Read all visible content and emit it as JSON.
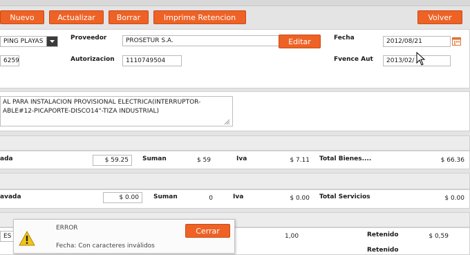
{
  "toolbar": {
    "nuevo": "Nuevo",
    "actualizar": "Actualizar",
    "borrar": "Borrar",
    "imprime": "Imprime Retencion",
    "volver": "Volver"
  },
  "header": {
    "select_value": "PING PLAYAS",
    "proveedor_label": "Proveedor",
    "proveedor_value": "PROSETUR S.A.",
    "editar": "Editar",
    "fecha_label": "Fecha",
    "fecha_value": "2012/08/21",
    "code_value": "6259",
    "autorizacion_label": "Autorizacion",
    "autorizacion_value": "1110749504",
    "fvence_label": "Fvence Aut",
    "fvence_value": "2013/02/"
  },
  "description": {
    "line1": "AL PARA INSTALACION PROVISIONAL ELECTRICA(INTERRUPTOR-",
    "line2": "ABLE#12-PICAPORTE-DISCO14\"-TIZA INDUSTRIAL)"
  },
  "bienes": {
    "gravada_label": "ada",
    "gravada_value": "$ 59.25",
    "suman_label": "Suman",
    "suman_value": "$ 59",
    "iva_label": "Iva",
    "iva_value": "$ 7.11",
    "total_label": "Total Bienes....",
    "total_value": "$ 66.36"
  },
  "servicios": {
    "gravada_label": "avada",
    "gravada_value": "$ 0.00",
    "suman_label": "Suman",
    "suman_value": "0",
    "iva_label": "Iva",
    "iva_value": "$ 0.00",
    "total_label": "Total Servicios",
    "total_value": "$ 0.00"
  },
  "retencion": {
    "left_text": "ES 1",
    "amount": "1,00",
    "retenido_label": "Retenido",
    "retenido_value": "$ 0,59",
    "next_label": "Retenido"
  },
  "error_dialog": {
    "title": "ERROR",
    "message": "Fecha: Con caracteres inválidos",
    "close_label": "Cerrar"
  },
  "icons": {
    "calendar": "calendar-icon",
    "warning": "warning-icon",
    "dropdown": "chevron-down-icon"
  },
  "colors": {
    "accent": "#ee6226",
    "background": "#e4e4e4"
  }
}
